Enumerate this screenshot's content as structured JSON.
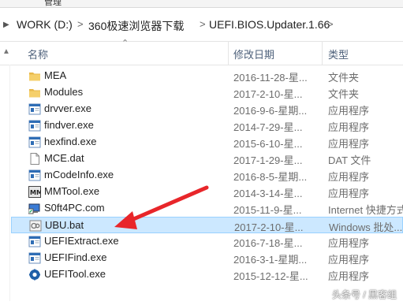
{
  "ribbon": {
    "tab_label": "管理"
  },
  "address": {
    "crumbs": [
      "WORK (D:)",
      "360极速浏览器下载",
      "UEFI.BIOS.Updater.1.66"
    ],
    "separator": ">"
  },
  "columns": {
    "name": "名称",
    "date": "修改日期",
    "type": "类型"
  },
  "files": [
    {
      "icon": "folder-icon",
      "name": "MEA",
      "date": "2016-11-28-星...",
      "type": "文件夹"
    },
    {
      "icon": "folder-icon",
      "name": "Modules",
      "date": "2017-2-10-星...",
      "type": "文件夹"
    },
    {
      "icon": "exe-icon",
      "name": "drvver.exe",
      "date": "2016-9-6-星期...",
      "type": "应用程序"
    },
    {
      "icon": "exe-icon",
      "name": "findver.exe",
      "date": "2014-7-29-星...",
      "type": "应用程序"
    },
    {
      "icon": "exe-icon",
      "name": "hexfind.exe",
      "date": "2015-6-10-星...",
      "type": "应用程序"
    },
    {
      "icon": "file-icon",
      "name": "MCE.dat",
      "date": "2017-1-29-星...",
      "type": "DAT 文件"
    },
    {
      "icon": "exe-icon",
      "name": "mCodeInfo.exe",
      "date": "2016-8-5-星期...",
      "type": "应用程序"
    },
    {
      "icon": "mmtool-icon",
      "name": "MMTool.exe",
      "date": "2014-3-14-星...",
      "type": "应用程序"
    },
    {
      "icon": "com-icon",
      "name": "S0ft4PC.com",
      "date": "2015-11-9-星...",
      "type": "Internet 快捷方式"
    },
    {
      "icon": "bat-icon",
      "name": "UBU.bat",
      "date": "2017-2-10-星...",
      "type": "Windows 批处..."
    },
    {
      "icon": "exe-icon",
      "name": "UEFIExtract.exe",
      "date": "2016-7-18-星...",
      "type": "应用程序"
    },
    {
      "icon": "exe-icon",
      "name": "UEFIFind.exe",
      "date": "2016-3-1-星期...",
      "type": "应用程序"
    },
    {
      "icon": "gear-icon",
      "name": "UEFITool.exe",
      "date": "2015-12-12-星...",
      "type": "应用程序"
    }
  ],
  "selected_index": 9,
  "watermark": "头条号 / 黑客组",
  "colors": {
    "selected_bg": "#cce8ff",
    "selected_border": "#99d1ff",
    "folder": "#e8b84b",
    "arrow": "#e8262a",
    "header_text": "#4d607a"
  }
}
